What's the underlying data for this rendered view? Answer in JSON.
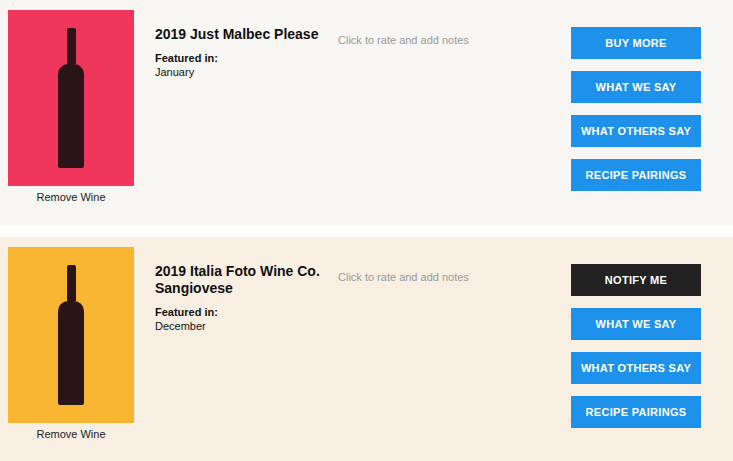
{
  "wines": [
    {
      "name": "2019 Just Malbec Please",
      "featured_label": "Featured in:",
      "month": "January",
      "rating_prompt": "Click to rate and add notes",
      "remove_label": "Remove Wine",
      "photo_color": "#f0365a",
      "buttons": [
        {
          "label": "BUY MORE",
          "kind": "primary"
        },
        {
          "label": "WHAT WE SAY",
          "kind": "primary"
        },
        {
          "label": "WHAT OTHERS SAY",
          "kind": "primary"
        },
        {
          "label": "RECIPE PAIRINGS",
          "kind": "primary"
        }
      ]
    },
    {
      "name": "2019 Italia Foto Wine Co. Sangiovese",
      "featured_label": "Featured in:",
      "month": "December",
      "rating_prompt": "Click to rate and add notes",
      "remove_label": "Remove Wine",
      "photo_color": "#f8b531",
      "buttons": [
        {
          "label": "NOTIFY ME",
          "kind": "dark"
        },
        {
          "label": "WHAT WE SAY",
          "kind": "primary"
        },
        {
          "label": "WHAT OTHERS SAY",
          "kind": "primary"
        },
        {
          "label": "RECIPE PAIRINGS",
          "kind": "primary"
        }
      ]
    }
  ]
}
